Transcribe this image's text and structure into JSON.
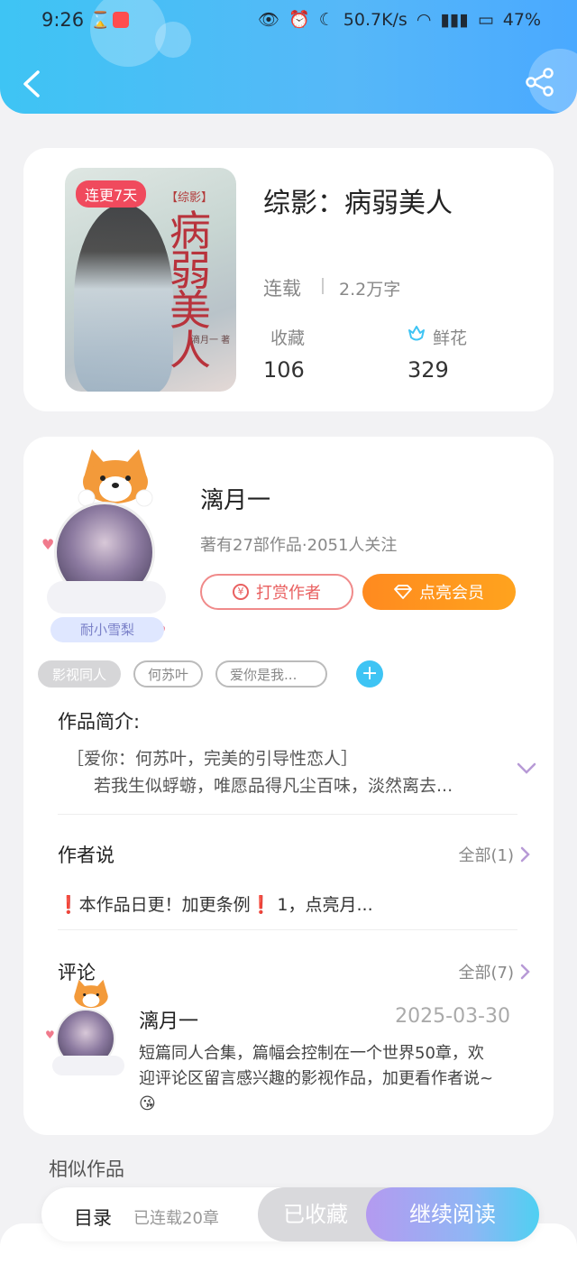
{
  "statusbar": {
    "time": "9:26",
    "network_speed": "50.7K/s",
    "battery": "47%"
  },
  "header": {
    "back_icon": "chevron-left-icon",
    "share_icon": "share-icon"
  },
  "book": {
    "cover_tag": "连更7天",
    "cover_genre": "【综影】",
    "cover_title_art": "病弱美人",
    "cover_author": "滴月一 著",
    "title": "综影：病弱美人",
    "status": "连载",
    "word_count": "2.2万字",
    "favorites_label": "收藏",
    "favorites_value": "106",
    "flowers_label": "鲜花",
    "flowers_value": "329"
  },
  "author": {
    "name": "漓月一",
    "meta": "著有27部作品·2051人关注",
    "badge": "耐小雪梨",
    "reward_label": "打赏作者",
    "vip_label": "点亮会员"
  },
  "tags": [
    "影视同人",
    "何苏叶",
    "爱你是我..."
  ],
  "intro": {
    "title": "作品简介:",
    "line1": "［爱你：何苏叶，完美的引导性恋人］",
    "line2": "若我生似蜉蝣，唯愿品得凡尘百味，淡然离去..."
  },
  "author_says": {
    "title": "作者说",
    "all": "全部(1)",
    "text_a": "本作品日更！加更条例",
    "text_b": "1，点亮月..."
  },
  "comments": {
    "title": "评论",
    "all": "全部(7)",
    "items": [
      {
        "name": "漓月一",
        "date": "2025-03-30",
        "text": "短篇同人合集，篇幅会控制在一个世界50章，欢迎评论区留言感兴趣的影视作品，加更看作者说~😘"
      }
    ]
  },
  "similar_title": "相似作品",
  "bottom": {
    "toc": "目录",
    "toc_sub": "已连载20章",
    "collected": "已收藏",
    "continue": "继续阅读"
  },
  "colors": {
    "accent": "#3ec4f4",
    "orange": "#ff8a1f",
    "red": "#e96060"
  }
}
